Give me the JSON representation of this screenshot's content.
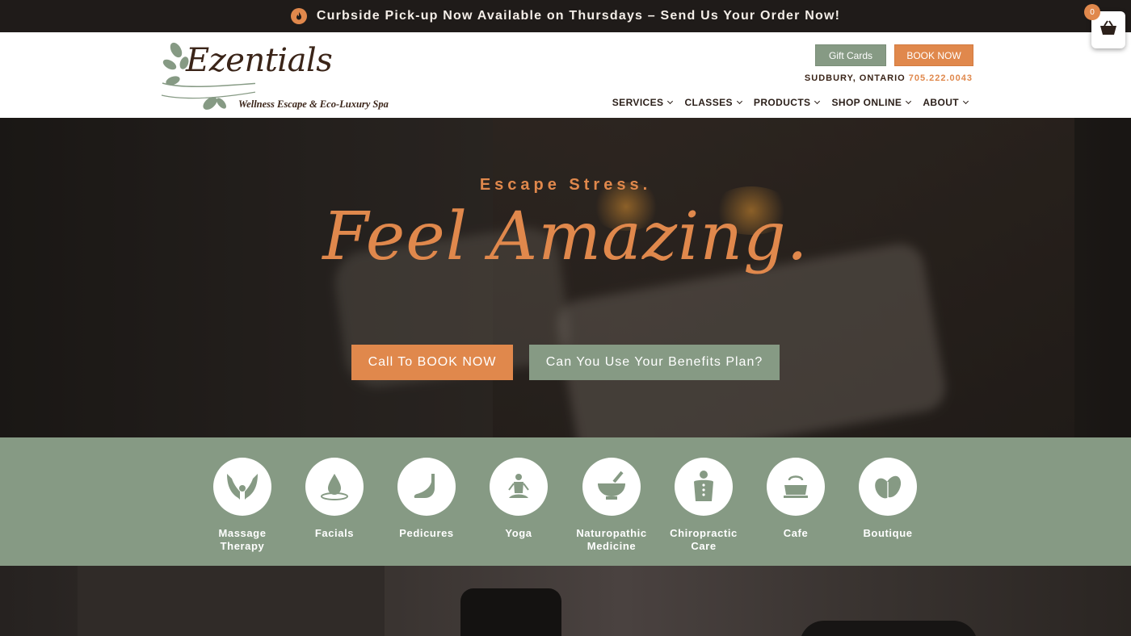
{
  "topbar": {
    "icon": "flame-icon",
    "message": "Curbside Pick-up Now Available on Thursdays – Send Us Your Order Now!"
  },
  "cart": {
    "icon": "basket-icon",
    "count": "0"
  },
  "header": {
    "logo": {
      "name": "Ezentials",
      "tagline": "Wellness Escape & Eco-Luxury Spa"
    },
    "gift_cards": "Gift Cards",
    "book_now": "BOOK NOW",
    "location": "SUDBURY, ONTARIO",
    "phone": "705.222.0043",
    "nav": [
      {
        "label": "SERVICES"
      },
      {
        "label": "CLASSES"
      },
      {
        "label": "PRODUCTS"
      },
      {
        "label": "SHOP ONLINE"
      },
      {
        "label": "ABOUT"
      }
    ]
  },
  "hero": {
    "eyebrow": "Escape Stress.",
    "headline": "Feel Amazing.",
    "call_button": "Call To BOOK NOW",
    "benefits_button": "Can You Use Your Benefits Plan?"
  },
  "services": [
    {
      "label": "Massage Therapy",
      "icon": "hands-icon"
    },
    {
      "label": "Facials",
      "icon": "water-drop-icon"
    },
    {
      "label": "Pedicures",
      "icon": "foot-icon"
    },
    {
      "label": "Yoga",
      "icon": "meditation-icon"
    },
    {
      "label": "Naturopathic Medicine",
      "icon": "mortar-pestle-icon"
    },
    {
      "label": "Chiropractic Care",
      "icon": "spine-icon"
    },
    {
      "label": "Cafe",
      "icon": "teapot-icon"
    },
    {
      "label": "Boutique",
      "icon": "leaves-icon"
    }
  ],
  "colors": {
    "accent": "#e0884c",
    "sage": "#869a84",
    "brown": "#3a2418"
  }
}
